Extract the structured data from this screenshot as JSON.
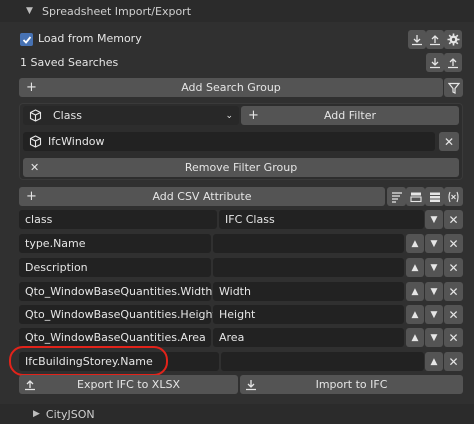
{
  "panel": {
    "title": "Spreadsheet Import/Export",
    "footer_title": "CityJSON"
  },
  "load_from_memory": {
    "label": "Load from Memory",
    "checked": true
  },
  "saved_searches": {
    "label": "1 Saved Searches"
  },
  "search_group": {
    "add_label": "Add Search Group"
  },
  "filter": {
    "type_value": "Class",
    "add_filter_label": "Add Filter",
    "class_value": "IfcWindow",
    "remove_label": "Remove Filter Group"
  },
  "csv": {
    "add_label": "Add CSV Attribute"
  },
  "attributes": [
    {
      "name": "class",
      "header": "IFC Class"
    },
    {
      "name": "type.Name",
      "header": ""
    },
    {
      "name": "Description",
      "header": ""
    },
    {
      "name": "Qto_WindowBaseQuantities.Width",
      "header": "Width"
    },
    {
      "name": "Qto_WindowBaseQuantities.Height",
      "header": "Height"
    },
    {
      "name": "Qto_WindowBaseQuantities.Area",
      "header": "Area"
    },
    {
      "name": "IfcBuildingStorey.Name",
      "header": ""
    }
  ],
  "actions": {
    "export_label": "Export IFC to XLSX",
    "import_label": "Import to IFC"
  },
  "colors": {
    "accent": "#4772b3",
    "highlight": "#e2231a"
  }
}
